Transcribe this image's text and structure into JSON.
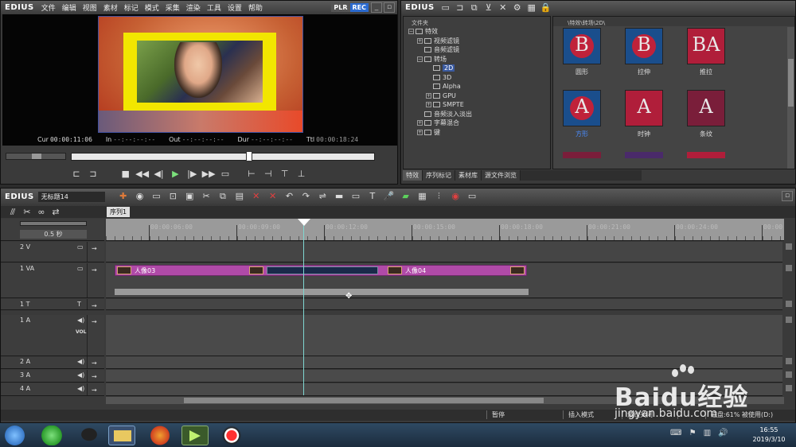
{
  "player": {
    "logo": "EDIUS",
    "menu": [
      "文件",
      "编辑",
      "视图",
      "素材",
      "标记",
      "模式",
      "采集",
      "渲染",
      "工具",
      "设置",
      "帮助"
    ],
    "mode_plr": "PLR",
    "mode_rec": "REC",
    "cur_label": "Cur",
    "cur_value": "00:00:11:06",
    "in_label": "In",
    "in_value": "--:--:--:--",
    "out_label": "Out",
    "out_value": "--:--:--:--",
    "dur_label": "Dur",
    "dur_value": "--:--:--:--",
    "ttl_label": "Ttl",
    "ttl_value": "00:00:18:24",
    "scrub_position": 0.59
  },
  "effects": {
    "logo": "EDIUS",
    "tree_header": "文件夹",
    "path": "\\特效\\转场\\2D\\",
    "tree": [
      {
        "label": "特效",
        "level": 0,
        "expand": "−",
        "icon": "folder"
      },
      {
        "label": "视频滤镜",
        "level": 1,
        "expand": "+",
        "icon": "folder"
      },
      {
        "label": "音频滤镜",
        "level": 1,
        "expand": "",
        "icon": "folder"
      },
      {
        "label": "转场",
        "level": 1,
        "expand": "−",
        "icon": "folder"
      },
      {
        "label": "2D",
        "level": 2,
        "expand": "",
        "icon": "fx",
        "selected": true
      },
      {
        "label": "3D",
        "level": 2,
        "expand": "",
        "icon": "fx"
      },
      {
        "label": "Alpha",
        "level": 2,
        "expand": "",
        "icon": "fx"
      },
      {
        "label": "GPU",
        "level": 2,
        "expand": "+",
        "icon": "fx"
      },
      {
        "label": "SMPTE",
        "level": 2,
        "expand": "+",
        "icon": "fx"
      },
      {
        "label": "音频淡入淡出",
        "level": 1,
        "expand": "",
        "icon": "folder"
      },
      {
        "label": "字幕混合",
        "level": 1,
        "expand": "+",
        "icon": "fx"
      },
      {
        "label": "键",
        "level": 1,
        "expand": "+",
        "icon": "fx"
      }
    ],
    "items": [
      {
        "label": "圆形",
        "letter": "B",
        "bg": "#1a4e8c",
        "fg": "#e8e8e8",
        "circle": "#c0223a",
        "selected": false
      },
      {
        "label": "拉伸",
        "letter": "B",
        "bg": "#1a4e8c",
        "fg": "#e8e8e8",
        "circle": "#c0223a",
        "selected": false
      },
      {
        "label": "推拉",
        "letter": "BA",
        "bg": "#b01e3a",
        "fg": "#e8e8e8",
        "circle": "",
        "selected": false
      },
      {
        "label": "方形",
        "letter": "A",
        "bg": "#1a4e8c",
        "fg": "#e8e8e8",
        "circle": "#c0223a",
        "selected": true
      },
      {
        "label": "时钟",
        "letter": "A",
        "bg": "#b01e3a",
        "fg": "#e8e8e8",
        "circle": "",
        "selected": false
      },
      {
        "label": "条纹",
        "letter": "A",
        "bg": "#7a1e3a",
        "fg": "#e8e8e8",
        "circle": "",
        "selected": false
      }
    ],
    "tabs": [
      "特效",
      "序列标记",
      "素材库",
      "源文件浏览"
    ]
  },
  "timeline": {
    "logo": "EDIUS",
    "project": "无标题14",
    "sequence_tab": "序列1",
    "zoom": "0.5 秒",
    "ruler": [
      "00:00:06:00",
      "00:00:09:00",
      "00:00:12:00",
      "00:00:15:00",
      "00:00:18:00",
      "00:00:21:00",
      "00:00:24:00",
      "00:00:2"
    ],
    "tracks": [
      {
        "name": "2 V"
      },
      {
        "name": "1 VA"
      },
      {
        "name": "1 T"
      },
      {
        "name": "1 A",
        "sub": "VOL"
      },
      {
        "name": "2 A"
      },
      {
        "name": "3 A"
      },
      {
        "name": "4 A"
      }
    ],
    "clip1_label": "人像03",
    "clip2_label": "人像04",
    "status": [
      "暂停",
      "插入模式",
      "波纹关闭",
      "",
      "磁盘:61% 被使用(D:)"
    ]
  },
  "taskbar": {
    "time": "16:55",
    "date": "2019/3/10"
  },
  "watermark": {
    "brand": "Baidu经验",
    "url": "jingyan.baidu.com"
  },
  "colors": {
    "clip_magenta": "#b04aa8",
    "rec_blue": "#2a6ad0",
    "playhead": "#7fd6d0",
    "yellow_frame": "#f2e600"
  }
}
